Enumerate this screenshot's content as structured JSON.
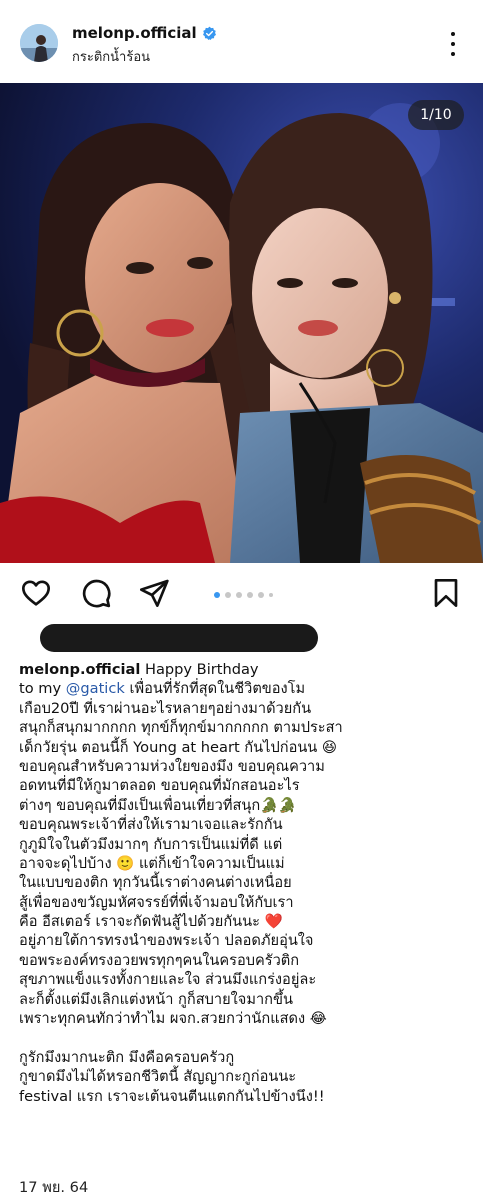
{
  "post": {
    "username": "melonp.official",
    "location": "กระติกน้ำร้อน",
    "image_counter": "1/10",
    "carousel": {
      "total_dots": 6,
      "active_index": 0
    },
    "date": "17 พย. 64"
  },
  "caption": {
    "username": "melonp.official",
    "first_line_text": " Happy Birthday",
    "line2_prefix": "to my ",
    "mention": "@gatick",
    "line2_suffix": " เพื่อนที่รักที่สุดในชีวิตของโม",
    "lines": [
      "เกือบ20ปี ที่เราผ่านอะไรหลายๆอย่างมาด้วยกัน",
      "สนุกก็สนุกมากกกก ทุกข์ก็ทุกข์มากกกกก ตามประสา",
      "เด็กวัยรุ่น ตอนนี้ก็ Young at heart กันไปก่อนน 😆",
      "ขอบคุณสำหรับความห่วงใยของมึง ขอบคุณความ",
      "อดทนที่มีให้กูมาตลอด ขอบคุณที่มักสอนอะไร",
      "ต่างๆ ขอบคุณที่มึงเป็นเพื่อนเที่ยวที่สนุก🐊🐊",
      "ขอบคุณพระเจ้าที่ส่งให้เรามาเจอและรักกัน",
      "กูภูมิใจในตัวมึงมากๆ กับการเป็นแม่ที่ดี แต่",
      "อาจจะดุไปบ้าง 🙂 แต่ก็เข้าใจความเป็นแม่",
      "ในแบบของติก ทุกวันนี้เราต่างคนต่างเหนื่อย",
      "สู้เพื่อของขวัญมหัศจรรย์ที่พี่เจ้ามอบให้กับเรา",
      "คือ อีสเตอร์ เราจะกัดฟันสู้ไปด้วยกันนะ ❤️",
      "อยู่ภายใต้การทรงนำของพระเจ้า ปลอดภัยอุ่นใจ",
      "ขอพระองค์ทรงอวยพรทุกๆคนในครอบครัวติก",
      "สุขภาพแข็งแรงทั้งกายและใจ ส่วนมึงแกร่งอยู่ละ",
      "ละก็ตั้งแต่มึงเลิกแต่งหน้า กูก็สบายใจมากขึ้น",
      "เพราะทุกคนทักว่าทำไม ผจก.สวยกว่านักแสดง 😂",
      "",
      " กูรักมึงมากนะติก มึงคือครอบครัวกู",
      "กูขาดมึงไม่ได้หรอกชีวิตนี้ สัญญากะกูก่อนนะ",
      "festival แรก เราจะเต้นจนตีนแตกกันไปข้างนึง!!"
    ]
  },
  "icons": {
    "verified": "verified-badge-icon",
    "more": "more-options-icon",
    "like": "heart-icon",
    "comment": "comment-icon",
    "share": "send-icon",
    "save": "bookmark-icon"
  },
  "colors": {
    "verified_blue": "#3897f0",
    "mention_blue": "#2a5aa8",
    "active_dot": "#3897f0",
    "inactive_dot": "#c7c7c7"
  }
}
